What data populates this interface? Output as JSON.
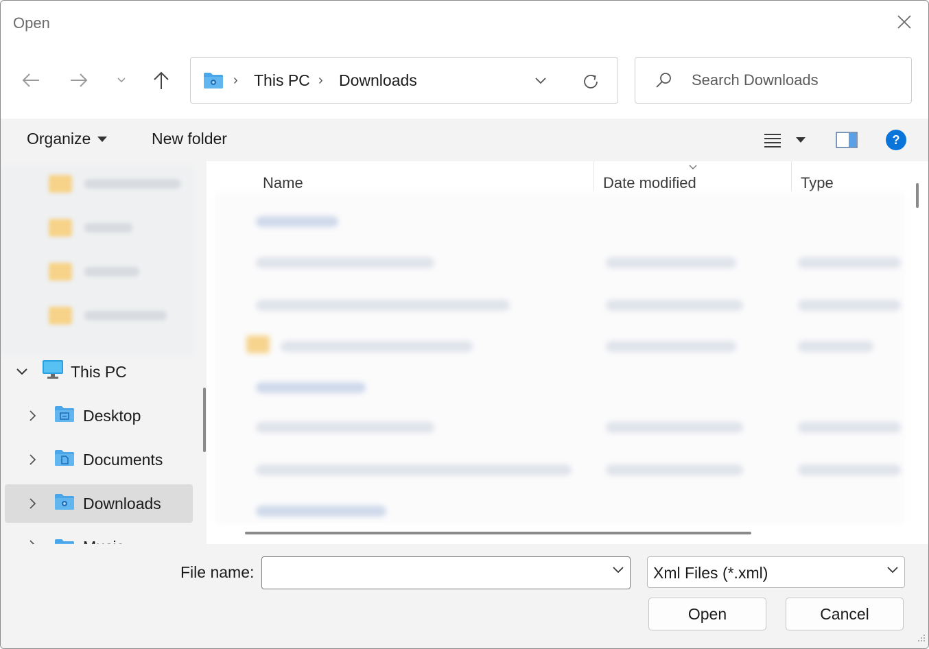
{
  "window": {
    "title": "Open"
  },
  "address": {
    "crumbs": [
      "This PC",
      "Downloads"
    ]
  },
  "search": {
    "placeholder": "Search Downloads"
  },
  "commandbar": {
    "organize_label": "Organize",
    "new_folder_label": "New folder"
  },
  "sidebar": {
    "items": [
      {
        "label": "This PC",
        "icon": "pc-icon",
        "expanded": true
      },
      {
        "label": "Desktop",
        "icon": "desktop-folder-icon"
      },
      {
        "label": "Documents",
        "icon": "documents-folder-icon"
      },
      {
        "label": "Downloads",
        "icon": "downloads-folder-icon",
        "selected": true
      },
      {
        "label": "Music",
        "icon": "music-folder-icon"
      }
    ]
  },
  "columns": {
    "name": "Name",
    "date_modified": "Date modified",
    "type": "Type"
  },
  "footer": {
    "file_name_label": "File name:",
    "file_name_value": "",
    "file_type_selected": "Xml Files (*.xml)",
    "open_label": "Open",
    "cancel_label": "Cancel"
  },
  "colors": {
    "accent": "#0a74da",
    "folder_blue": "#4aa6e8",
    "selected_bg": "#dcdcdc",
    "chrome_bg": "#f3f3f3"
  }
}
